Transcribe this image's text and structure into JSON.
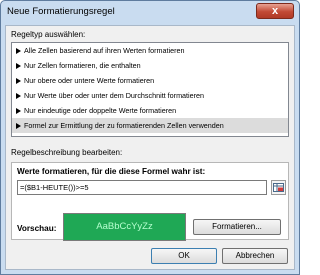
{
  "window": {
    "title": "Neue Formatierungsregel",
    "close_glyph": "x"
  },
  "rule_type": {
    "label": "Regeltyp auswählen:",
    "items": [
      {
        "label": "Alle Zellen basierend auf ihren Werten formatieren",
        "selected": false
      },
      {
        "label": "Nur Zellen formatieren, die enthalten",
        "selected": false
      },
      {
        "label": "Nur obere oder untere Werte formatieren",
        "selected": false
      },
      {
        "label": "Nur Werte über oder unter dem Durchschnitt formatieren",
        "selected": false
      },
      {
        "label": "Nur eindeutige oder doppelte Werte formatieren",
        "selected": false
      },
      {
        "label": "Formel zur Ermittlung der zu formatierenden Zellen verwenden",
        "selected": true
      }
    ]
  },
  "rule_description": {
    "label": "Regelbeschreibung bearbeiten:",
    "formula_label": "Werte formatieren, für die diese Formel wahr ist:",
    "formula_value": "=($B1-HEUTE())>=5",
    "preview_label": "Vorschau:",
    "preview_text": "AaBbCcYyZz",
    "preview_fill": "#1fa855",
    "format_button": "Formatieren..."
  },
  "footer": {
    "ok_button": "OK",
    "cancel_button": "Abbrechen"
  },
  "colors": {
    "window_frame": "#c9dcf0",
    "close_button": "#c24a35"
  }
}
